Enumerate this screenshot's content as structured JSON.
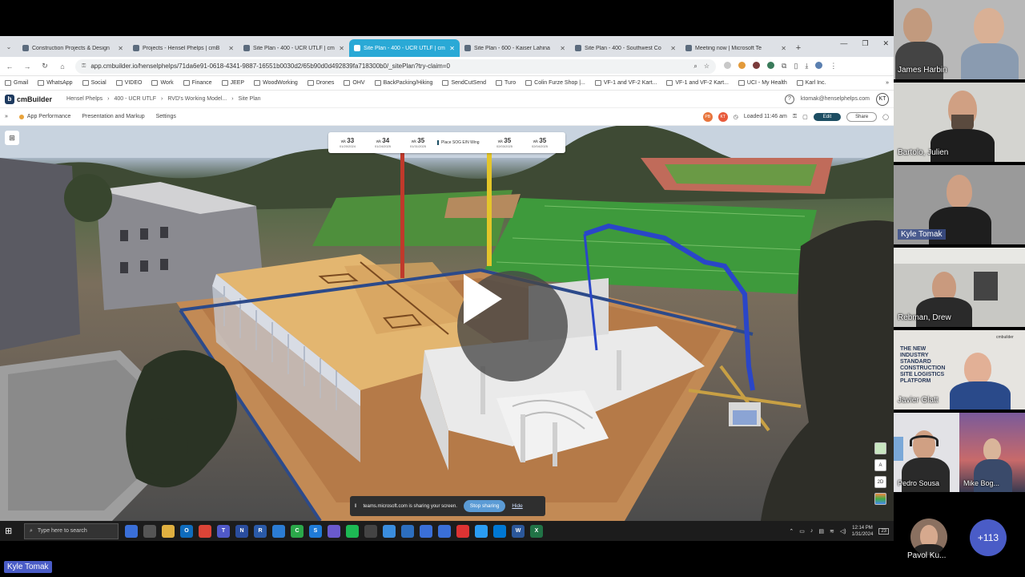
{
  "browser": {
    "tabs": [
      {
        "label": "Construction Projects & Design",
        "active": false
      },
      {
        "label": "Projects - Hensel Phelps | cmB",
        "active": false
      },
      {
        "label": "Site Plan - 400 - UCR UTLF | cm",
        "active": false
      },
      {
        "label": "Site Plan - 400 - UCR UTLF | cm",
        "active": true
      },
      {
        "label": "Site Plan - 600 - Kaiser Lahina",
        "active": false
      },
      {
        "label": "Site Plan - 400 - Southwest Co",
        "active": false
      },
      {
        "label": "Meeting now | Microsoft Te",
        "active": false
      }
    ],
    "url": "app.cmbuilder.io/henselphelps/71da6e91-0618-4341-9887-16551b0030d2/65b90d0d492839fa718300b0/_sitePlan?try-claim=0",
    "bookmarks": [
      "Gmail",
      "WhatsApp",
      "Social",
      "VIDEO",
      "Work",
      "Finance",
      "JEEP",
      "WoodWorking",
      "Drones",
      "OHV",
      "BackPacking/Hiking",
      "SendCutSend",
      "Turo",
      "Colin Furze Shop |...",
      "VF-1 and VF-2 Kart...",
      "VF-1 and VF-2 Kart...",
      "UCI - My Health",
      "Karl Inc."
    ]
  },
  "app": {
    "logo_text": "cmBuilder",
    "breadcrumbs": [
      "Hensel Phelps",
      "400 - UCR UTLF",
      "RVD's Working Model...",
      "Site Plan"
    ],
    "user_email": "ktomak@henselphelps.com",
    "user_initials": "KT",
    "menu": [
      "App Performance",
      "Presentation and Markup",
      "Settings"
    ],
    "presence": [
      {
        "initials": "PB",
        "color": "#e8743b"
      },
      {
        "initials": "KT",
        "color": "#e85a3b"
      }
    ],
    "loaded_text": "Loaded 11:46 am",
    "edit_label": "Edit",
    "share_label": "Share"
  },
  "timeline": {
    "weeks": [
      {
        "wk_label": "wk",
        "num": "33",
        "date": "01/20/2024"
      },
      {
        "wk_label": "wk",
        "num": "34",
        "date": "01/24/2025"
      },
      {
        "wk_label": "wk",
        "num": "35",
        "date": "01/31/2025"
      },
      {
        "wk_label": "wk",
        "num": "35",
        "date": "02/03/2025"
      },
      {
        "wk_label": "wk",
        "num": "35",
        "date": "02/04/2025"
      }
    ],
    "event": "Place SOG E/N Wing"
  },
  "right_tools": [
    "",
    "A",
    "2D",
    ""
  ],
  "sharing": {
    "text": "teams.microsoft.com is sharing your screen.",
    "stop_label": "Stop sharing",
    "hide_label": "Hide"
  },
  "taskbar": {
    "search_placeholder": "Type here to search",
    "apps": [
      {
        "glyph": "",
        "color": "#3a6fd8"
      },
      {
        "glyph": "",
        "color": "#555"
      },
      {
        "glyph": "",
        "color": "#e0b040"
      },
      {
        "glyph": "O",
        "color": "#0f6cbd"
      },
      {
        "glyph": "",
        "color": "#db4437"
      },
      {
        "glyph": "T",
        "color": "#5059c9"
      },
      {
        "glyph": "N",
        "color": "#2a4d9e"
      },
      {
        "glyph": "R",
        "color": "#2a5aa8"
      },
      {
        "glyph": "",
        "color": "#2b7cd3"
      },
      {
        "glyph": "C",
        "color": "#2ba84a"
      },
      {
        "glyph": "S",
        "color": "#1f7bd8"
      },
      {
        "glyph": "",
        "color": "#6a5acd"
      },
      {
        "glyph": "",
        "color": "#1db954"
      },
      {
        "glyph": "",
        "color": "#444"
      },
      {
        "glyph": "",
        "color": "#3a8dde"
      },
      {
        "glyph": "",
        "color": "#2c6ebf"
      },
      {
        "glyph": "",
        "color": "#3a6fd8"
      },
      {
        "glyph": "",
        "color": "#3a6fd8"
      },
      {
        "glyph": "",
        "color": "#d33"
      },
      {
        "glyph": "",
        "color": "#2a9df4"
      },
      {
        "glyph": "",
        "color": "#0078d4"
      },
      {
        "glyph": "W",
        "color": "#2b579a"
      },
      {
        "glyph": "X",
        "color": "#217346"
      }
    ],
    "time": "12:14 PM",
    "date": "1/31/2024",
    "notif_count": "23"
  },
  "participants": [
    {
      "name": "James Harbin",
      "boxed": false,
      "bg": "#b8b8b8"
    },
    {
      "name": "Bartolo, Julien",
      "boxed": false,
      "bg": "#d4d4d0"
    },
    {
      "name": "Kyle Tomak",
      "boxed": true,
      "bg": "#9a9a9a"
    },
    {
      "name": "Rebman, Drew",
      "boxed": false,
      "bg": "#c8c8c4"
    },
    {
      "name": "Javier Glatt",
      "boxed": false,
      "bg": "#e6e4e0"
    },
    {
      "name": "Pedro Sousa",
      "boxed": false,
      "bg": "#e2e2e6"
    },
    {
      "name": "Mike Bog...",
      "boxed": false,
      "bg": "#6a5a7a"
    }
  ],
  "javier_bg_text": "THE NEW INDUSTRY STANDARD CONSTRUCTION SITE LOGISTICS PLATFORM",
  "javier_brand": "cmbuilder",
  "overflow": {
    "name": "Pavol Ku...",
    "more_count": "+113"
  },
  "active_speaker": "Kyle Tomak"
}
